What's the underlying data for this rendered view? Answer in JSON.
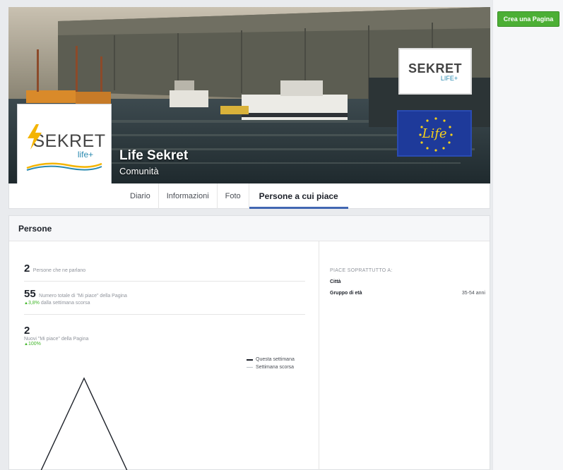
{
  "right_rail": {
    "create_page_label": "Crea una Pagina"
  },
  "cover": {
    "logo_word": "SEKRET",
    "logo_sub": "LIFE+",
    "eu_logo_text": "Life"
  },
  "profile": {
    "logo_word": "SEKRET",
    "logo_sub": "life+",
    "name": "Life Sekret",
    "category": "Comunità"
  },
  "tabs": [
    {
      "label": "Diario",
      "active": false
    },
    {
      "label": "Informazioni",
      "active": false
    },
    {
      "label": "Foto",
      "active": false
    },
    {
      "label": "Persone a cui piace",
      "active": true
    }
  ],
  "people": {
    "header": "Persone",
    "talking_count": "2",
    "talking_label": "Persone che ne parlano",
    "total_likes": "55",
    "total_likes_label": "Numero totale di \"Mi piace\" della Pagina",
    "total_change": "3,8%",
    "total_change_label": "dalla settimana scorsa",
    "new_likes": "2",
    "new_likes_label": "Nuovi \"Mi piace\" della Pagina",
    "new_change": "100%",
    "legend_this_week": "Questa settimana",
    "legend_last_week": "Settimana scorsa"
  },
  "demographics": {
    "title": "PIACE SOPRATTUTTO A:",
    "city_label": "Città",
    "city_value": "",
    "age_label": "Gruppo di età",
    "age_value": "35-54 anni"
  },
  "chart_data": {
    "type": "line",
    "series": [
      {
        "name": "Questa settimana",
        "values": [
          0,
          2,
          0
        ]
      }
    ],
    "color": "#1d2129"
  },
  "colors": {
    "accent_blue": "#4267b2",
    "positive_green": "#42b72a",
    "create_page_green": "#4caf35"
  }
}
